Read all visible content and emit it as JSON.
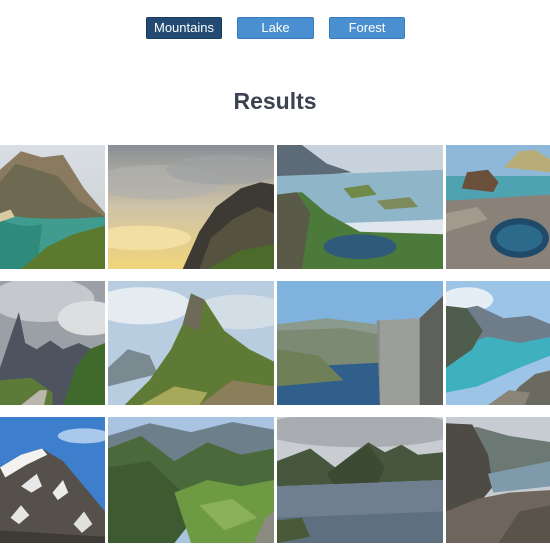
{
  "filters": [
    {
      "label": "Mountains",
      "active": true
    },
    {
      "label": "Lake",
      "active": false
    },
    {
      "label": "Forest",
      "active": false
    }
  ],
  "results_heading": "Results",
  "images": [
    {
      "subject": "cliff-over-turquoise-bay"
    },
    {
      "subject": "rocky-peak-at-sunset-clouds"
    },
    {
      "subject": "lakes-and-islands-aerial"
    },
    {
      "subject": "coastal-rock-pools"
    },
    {
      "subject": "jagged-peaks-with-road"
    },
    {
      "subject": "green-ridge-peak"
    },
    {
      "subject": "cliff-plateau-over-fjord"
    },
    {
      "subject": "turquoise-fjord-from-above"
    },
    {
      "subject": "snowy-rock-face"
    },
    {
      "subject": "green-valley-mountains"
    },
    {
      "subject": "mountain-lake-islands"
    },
    {
      "subject": "rocky-cliffs-over-lake"
    }
  ],
  "colors": {
    "active_button": "#234a73",
    "button": "#4a8fcf",
    "heading": "#3b4350"
  }
}
